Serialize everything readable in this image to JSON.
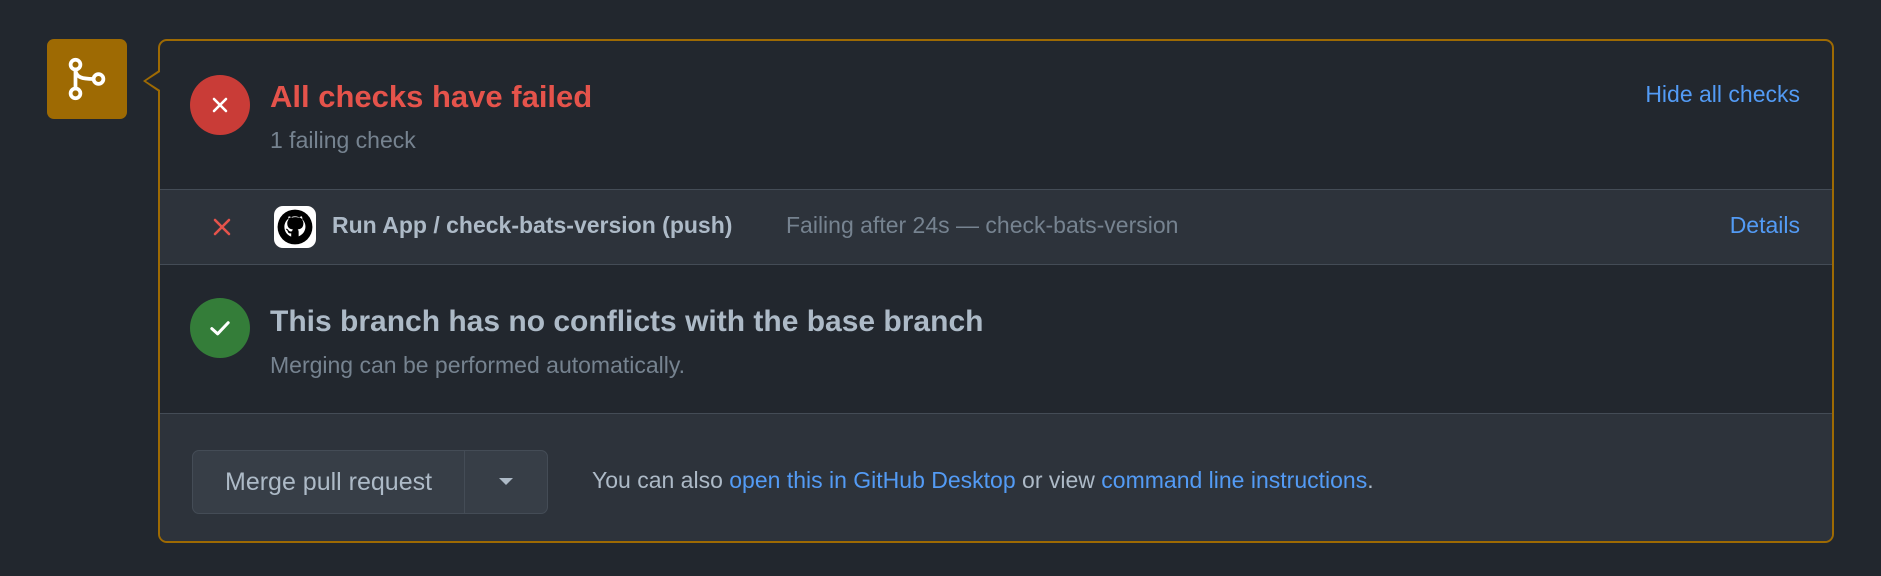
{
  "icons": {
    "merge": "git-merge-icon",
    "fail": "x-circle-icon",
    "success": "check-circle-icon",
    "row_fail": "x-icon",
    "provider": "github-logo-icon",
    "caret": "triangle-down-icon"
  },
  "colors": {
    "attention_border": "#9e6a03",
    "danger": "#e5534b",
    "danger_bg": "#c93c37",
    "success_bg": "#347d39",
    "link": "#539bf5",
    "background": "#22272e",
    "panel": "#2d333b"
  },
  "checks": {
    "title": "All checks have failed",
    "subtitle": "1 failing check",
    "hide_label": "Hide all checks"
  },
  "check_row": {
    "name": "Run App / check-bats-version (push)",
    "description": "Failing after 24s — check-bats-version",
    "details_label": "Details"
  },
  "conflicts": {
    "title": "This branch has no conflicts with the base branch",
    "subtitle": "Merging can be performed automatically."
  },
  "merge": {
    "button_label": "Merge pull request",
    "hint_prefix": "You can also ",
    "desktop_link": "open this in GitHub Desktop",
    "hint_middle": " or view ",
    "cli_link": "command line instructions",
    "hint_suffix": "."
  }
}
